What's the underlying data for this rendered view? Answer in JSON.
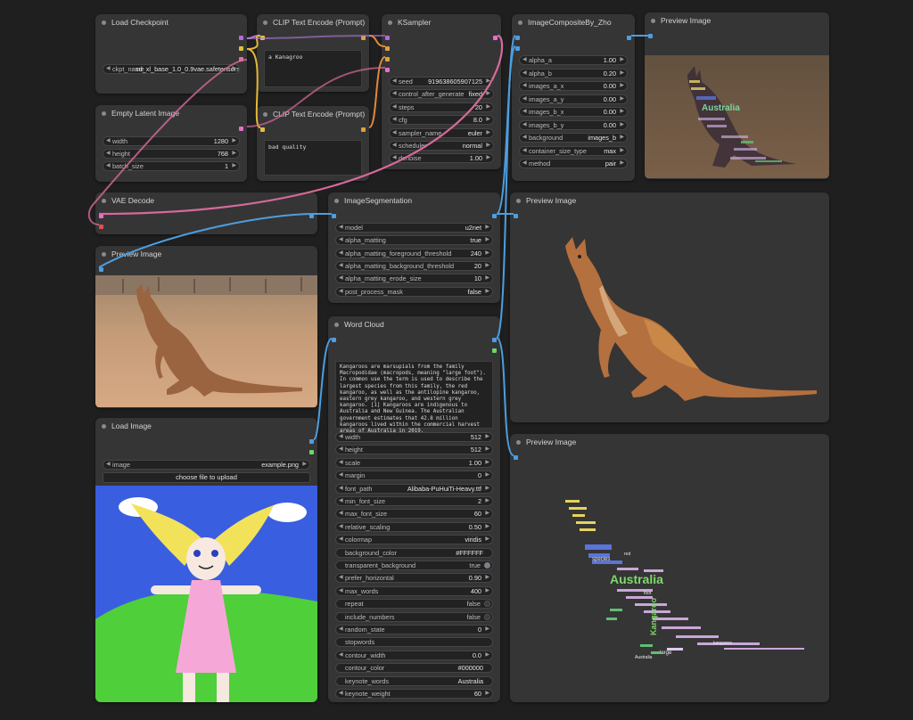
{
  "nodes": {
    "load_checkpoint": {
      "title": "Load Checkpoint",
      "ckpt_label": "ckpt_name",
      "ckpt_value": "sd_xl_base_1.0_0.9vae.safetensors"
    },
    "empty_latent": {
      "title": "Empty Latent Image",
      "width_label": "width",
      "width": "1280",
      "height_label": "height",
      "height": "768",
      "batch_label": "batch_size",
      "batch": "1"
    },
    "clip_pos": {
      "title": "CLIP Text Encode (Prompt)",
      "text": "a Kanagroo"
    },
    "clip_neg": {
      "title": "CLIP Text Encode (Prompt)",
      "text": "bad quality"
    },
    "ksampler": {
      "title": "KSampler",
      "rows": [
        {
          "label": "seed",
          "value": "919638605907125"
        },
        {
          "label": "control_after_generate",
          "value": "fixed"
        },
        {
          "label": "steps",
          "value": "20"
        },
        {
          "label": "cfg",
          "value": "8.0"
        },
        {
          "label": "sampler_name",
          "value": "euler"
        },
        {
          "label": "scheduler",
          "value": "normal"
        },
        {
          "label": "denoise",
          "value": "1.00"
        }
      ]
    },
    "composite": {
      "title": "ImageCompositeBy_Zho",
      "rows": [
        {
          "label": "alpha_a",
          "value": "1.00"
        },
        {
          "label": "alpha_b",
          "value": "0.20"
        },
        {
          "label": "images_a_x",
          "value": "0.00"
        },
        {
          "label": "images_a_y",
          "value": "0.00"
        },
        {
          "label": "images_b_x",
          "value": "0.00"
        },
        {
          "label": "images_b_y",
          "value": "0.00"
        },
        {
          "label": "background",
          "value": "images_b"
        },
        {
          "label": "container_size_type",
          "value": "max"
        },
        {
          "label": "method",
          "value": "pair"
        }
      ]
    },
    "preview_top": {
      "title": "Preview Image",
      "wordcloud_word": "Australia"
    },
    "vae_decode": {
      "title": "VAE Decode"
    },
    "segmentation": {
      "title": "ImageSegmentation",
      "rows": [
        {
          "label": "model",
          "value": "u2net"
        },
        {
          "label": "alpha_matting",
          "value": "true"
        },
        {
          "label": "alpha_matting_foreground_threshold",
          "value": "240"
        },
        {
          "label": "alpha_matting_background_threshold",
          "value": "20"
        },
        {
          "label": "alpha_matting_erode_size",
          "value": "10"
        },
        {
          "label": "post_process_mask",
          "value": "false"
        }
      ]
    },
    "preview_mid": {
      "title": "Preview Image"
    },
    "preview_left": {
      "title": "Preview Image"
    },
    "wordcloud": {
      "title": "Word Cloud",
      "text": "Kangaroos are marsupials from the family Macropodidae (macropods, meaning \"large foot\"). In common use the term is used to describe the largest species from this family, the red kangaroo, as well as the antilopine kangaroo, eastern grey kangaroo, and western grey kangaroo. [1] Kangaroos are indigenous to Australia and New Guinea. The Australian government estimates that 42.8 million kangaroos lived within the commercial harvest areas of Australia in 2019.",
      "rows": [
        {
          "label": "width",
          "value": "512",
          "kind": "num"
        },
        {
          "label": "height",
          "value": "512",
          "kind": "num"
        },
        {
          "label": "scale",
          "value": "1.00",
          "kind": "num"
        },
        {
          "label": "margin",
          "value": "0",
          "kind": "num"
        },
        {
          "label": "font_path",
          "value": "Alibaba-PuHuiTi-Heavy.ttf",
          "kind": "num"
        },
        {
          "label": "min_font_size",
          "value": "2",
          "kind": "num"
        },
        {
          "label": "max_font_size",
          "value": "60",
          "kind": "num"
        },
        {
          "label": "relative_scaling",
          "value": "0.50",
          "kind": "num"
        },
        {
          "label": "colormap",
          "value": "viridis",
          "kind": "num"
        },
        {
          "label": "background_color",
          "value": "#FFFFFF",
          "kind": "text"
        },
        {
          "label": "transparent_background",
          "value": "true",
          "kind": "toggle_on"
        },
        {
          "label": "prefer_horizontal",
          "value": "0.90",
          "kind": "num"
        },
        {
          "label": "max_words",
          "value": "400",
          "kind": "num"
        },
        {
          "label": "repeat",
          "value": "false",
          "kind": "toggle_off"
        },
        {
          "label": "include_numbers",
          "value": "false",
          "kind": "toggle_off"
        },
        {
          "label": "random_state",
          "value": "0",
          "kind": "num"
        },
        {
          "label": "stopwords",
          "value": "",
          "kind": "text"
        },
        {
          "label": "contour_width",
          "value": "0.0",
          "kind": "num"
        },
        {
          "label": "contour_color",
          "value": "#000000",
          "kind": "text"
        },
        {
          "label": "keynote_words",
          "value": "Australia",
          "kind": "text"
        },
        {
          "label": "keynote_weight",
          "value": "60",
          "kind": "num"
        }
      ]
    },
    "load_image": {
      "title": "Load Image",
      "image_label": "image",
      "image_value": "example.png",
      "upload_label": "choose file to upload"
    },
    "preview_bottom": {
      "title": "Preview Image",
      "wordcloud_word": "Australia",
      "side_word": "Kangaroo",
      "small_words": [
        "species",
        "large",
        "kangaroo",
        "Australia",
        "foot",
        "red"
      ]
    }
  },
  "colors": {
    "accent_blue": "#4d9ee0",
    "wire_pink": "#d66a9a",
    "wire_yellow": "#e5b93a",
    "wire_orange": "#e08a3a",
    "port_pink": "#e36fd0",
    "port_red": "#e35050"
  }
}
